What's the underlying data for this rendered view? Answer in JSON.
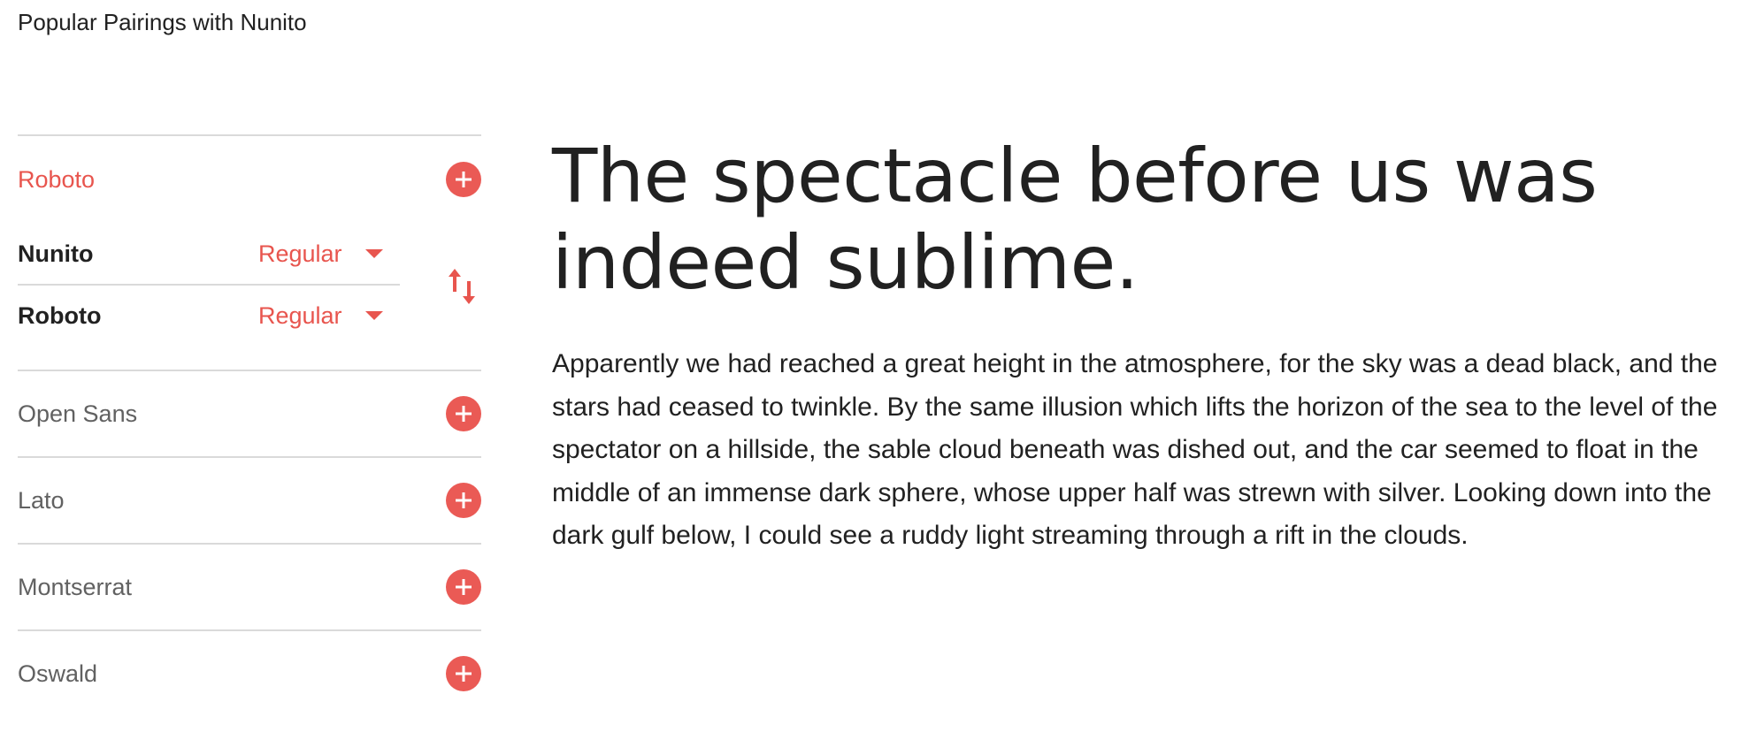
{
  "section_title": "Popular Pairings with Nunito",
  "colors": {
    "accent": "#ea5a55",
    "text": "#212121",
    "muted": "#616161",
    "divider": "#dadada"
  },
  "pairings": {
    "selected": {
      "name": "Roboto",
      "add_icon": "plus-circle-icon",
      "pair": [
        {
          "family": "Nunito",
          "weight": "Regular"
        },
        {
          "family": "Roboto",
          "weight": "Regular"
        }
      ],
      "swap_icon": "swap-vertical-icon"
    },
    "others": [
      {
        "name": "Open Sans",
        "add_icon": "plus-circle-icon"
      },
      {
        "name": "Lato",
        "add_icon": "plus-circle-icon"
      },
      {
        "name": "Montserrat",
        "add_icon": "plus-circle-icon"
      },
      {
        "name": "Oswald",
        "add_icon": "plus-circle-icon"
      }
    ]
  },
  "preview": {
    "headline": "The spectacle before us was indeed sublime.",
    "body": "Apparently we had reached a great height in the atmosphere, for the sky was a dead black, and the stars had ceased to twinkle. By the same illusion which lifts the horizon of the sea to the level of the spectator on a hillside, the sable cloud beneath was dished out, and the car seemed to float in the middle of an immense dark sphere, whose upper half was strewn with silver. Looking down into the dark gulf below, I could see a ruddy light streaming through a rift in the clouds."
  }
}
